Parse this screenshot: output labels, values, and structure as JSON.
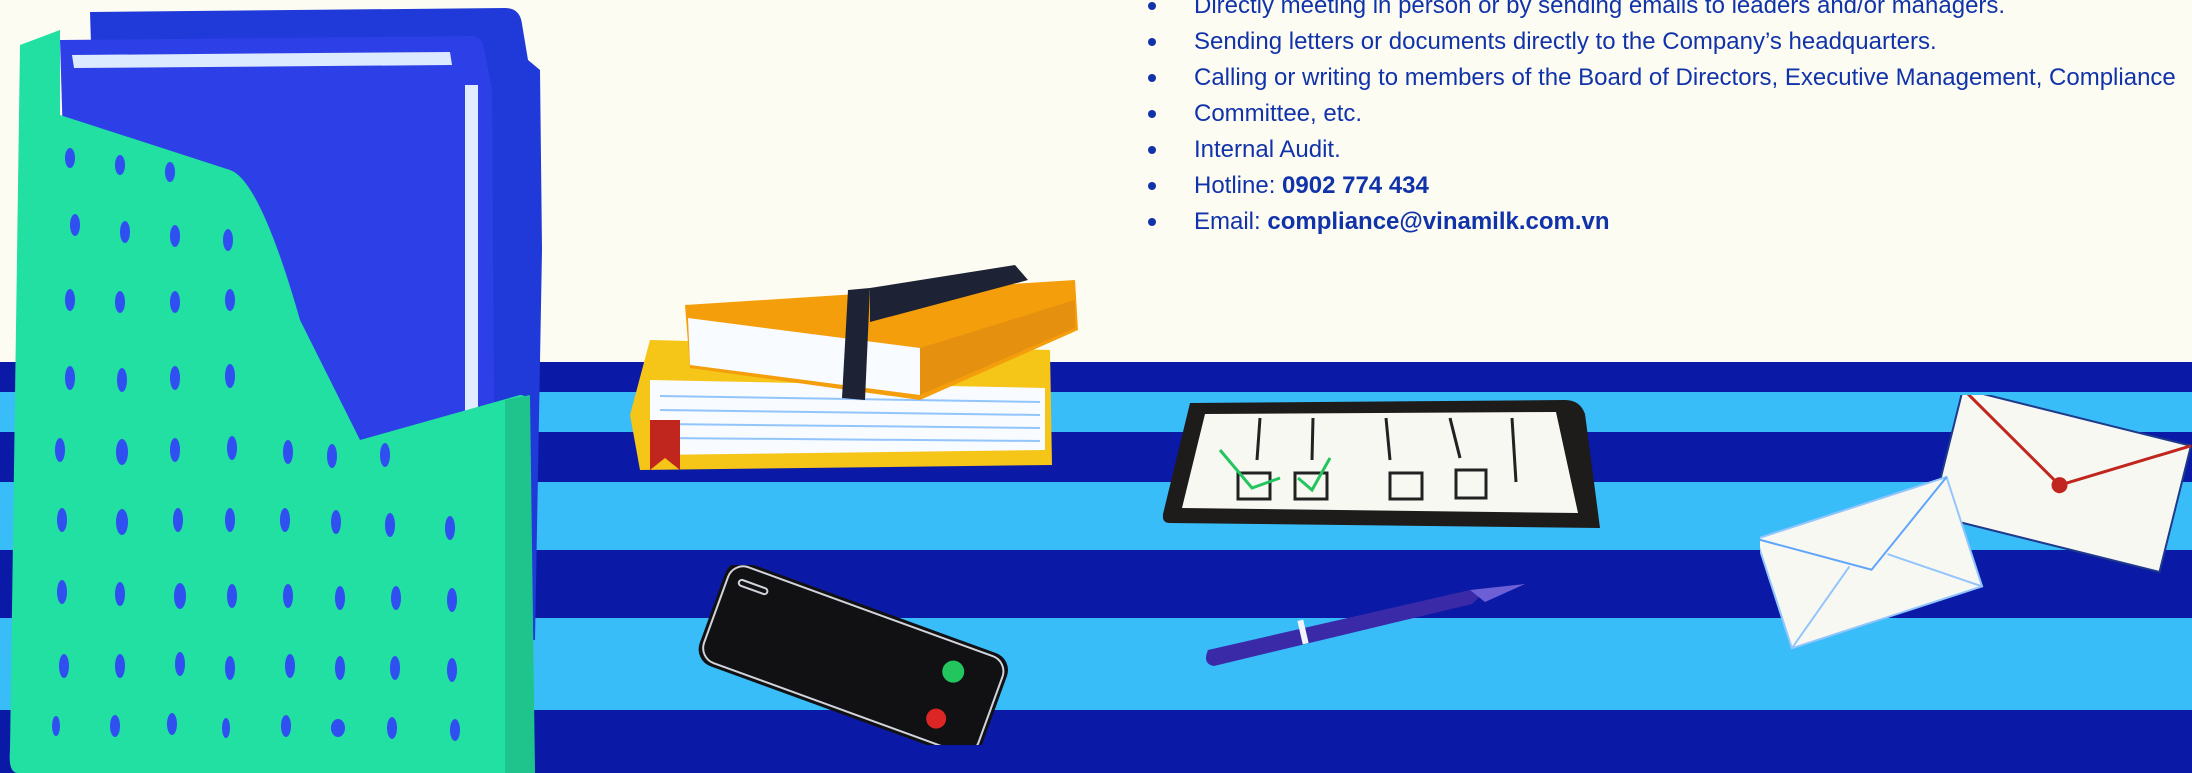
{
  "contact_channels": {
    "items": [
      {
        "text": "Directly meeting in person or by sending emails to leaders and/or managers."
      },
      {
        "text": "Sending letters or documents directly to the Company’s headquarters."
      },
      {
        "text": "Calling or writing to members of the Board of Directors, Executive Management, Compliance"
      },
      {
        "text": "Committee, etc.",
        "continuation": true
      },
      {
        "text": "Internal Audit."
      },
      {
        "label": "Hotline: ",
        "value": "0902 774 434"
      },
      {
        "label": "Email: ",
        "value": "compliance@vinamilk.com.vn"
      }
    ]
  },
  "illustration": {
    "objects": [
      "file-holder",
      "book-stack",
      "smartphone",
      "checklist-tablet",
      "pen",
      "envelopes"
    ],
    "colors": {
      "background": "#fdfcf2",
      "stripe_dark": "#0a1aa6",
      "stripe_light": "#38bdf8",
      "text": "#1133aa",
      "holder_green": "#22e0a2",
      "folder_blue": "#2d3fe6",
      "book_orange": "#f59e0b",
      "book_yellow": "#f5c518"
    }
  }
}
